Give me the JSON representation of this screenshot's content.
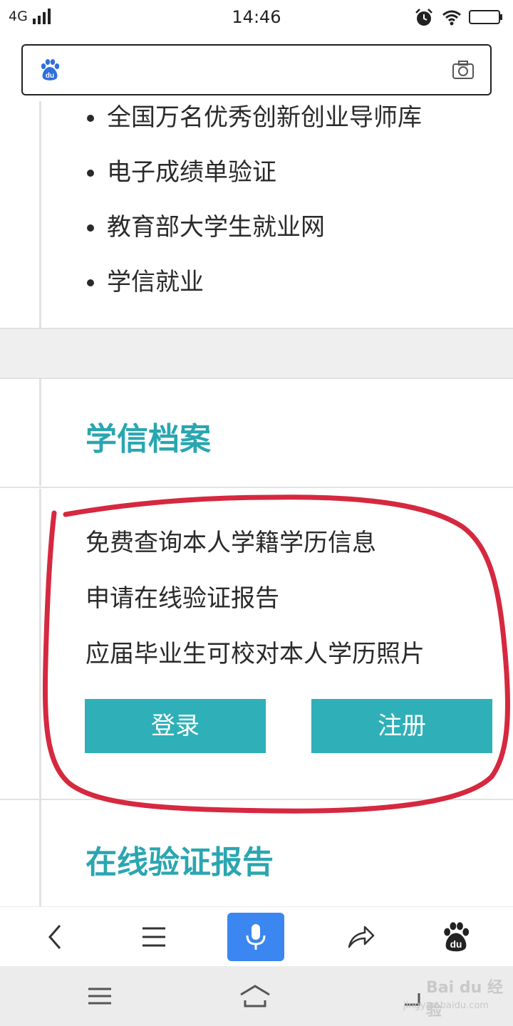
{
  "status_bar": {
    "network": "4G",
    "time": "14:46",
    "icons": [
      "signal-icon",
      "alarm-icon",
      "wifi-icon",
      "battery-icon"
    ]
  },
  "search_bar": {
    "logo_icon": "baidu-paw-icon",
    "logo_text": "du",
    "camera_icon": "camera-icon"
  },
  "link_list": {
    "items": [
      "全国万名优秀创新创业导师库",
      "电子成绩单验证",
      "教育部大学生就业网",
      "学信就业"
    ]
  },
  "xuexin_archive": {
    "title": "学信档案",
    "lines": [
      "免费查询本人学籍学历信息",
      "申请在线验证报告",
      "应届毕业生可校对本人学历照片"
    ],
    "login_label": "登录",
    "register_label": "注册"
  },
  "online_report": {
    "title": "在线验证报告"
  },
  "browser_toolbar": {
    "icons": [
      "back-icon",
      "menu-icon",
      "microphone-icon",
      "share-icon",
      "baidu-paw-icon"
    ]
  },
  "system_nav": {
    "icons": [
      "recent-apps-icon",
      "home-icon",
      "back-nav-icon"
    ]
  },
  "watermark": {
    "text": "Bai du 经验",
    "url": "jingyan.baidu.com"
  },
  "colors": {
    "accent": "#2aa6b0",
    "button": "#2fb0b8",
    "mic_button": "#3b86f0",
    "annotation": "#d6283f"
  }
}
